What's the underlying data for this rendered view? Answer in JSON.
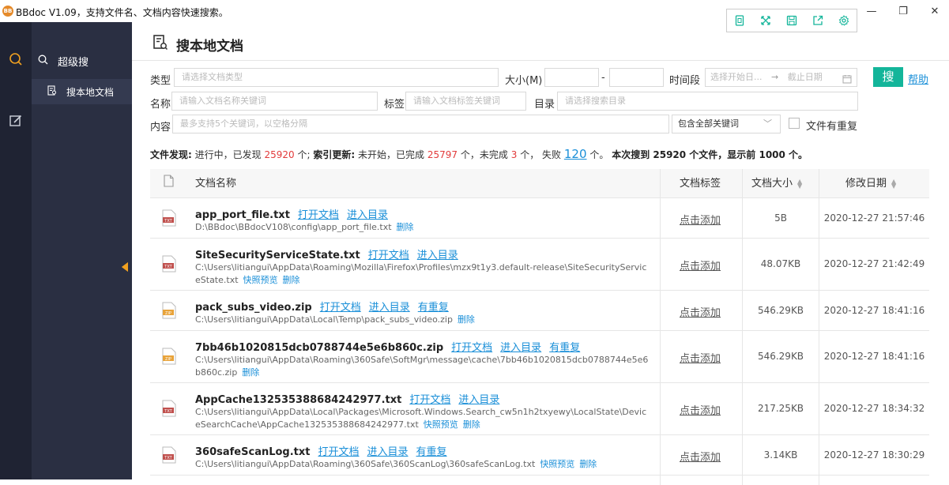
{
  "app": {
    "title": "BBdoc V1.09，支持文件名、文档内容快速搜索。",
    "logo_text": "BB"
  },
  "toolbar": {
    "icons": [
      "sim-card-icon",
      "fullscreen-icon",
      "save-icon",
      "share-icon",
      "settings-icon"
    ]
  },
  "window": {
    "minimize": "—",
    "restore": "❐",
    "close": "✕"
  },
  "subnav": {
    "section": "超级搜",
    "item": "搜本地文档"
  },
  "page": {
    "title": "搜本地文档"
  },
  "form": {
    "type_label": "类型",
    "type_placeholder": "请选择文档类型",
    "size_label": "大小(M)",
    "size_sep": "-",
    "period_label": "时间段",
    "start_placeholder": "选择开始日...",
    "end_placeholder": "截止日期",
    "name_label": "名称",
    "name_placeholder": "请输入文档名称关键词",
    "tag_label": "标签",
    "tag_placeholder": "请输入文档标签关键词",
    "dir_label": "目录",
    "dir_placeholder": "请选择搜索目录",
    "content_label": "内容",
    "content_placeholder": "最多支持5个关键词，以空格分隔",
    "match_mode": "包含全部关键词",
    "dup_label": "文件有重复",
    "search_button": "搜",
    "help_link": "帮助"
  },
  "stats": {
    "discover_label": "文件发现:",
    "discover_status": "进行中，已发现",
    "discover_count": "25920",
    "unit1": "个;",
    "index_label": "索引更新:",
    "index_status": "未开始，已完成",
    "index_done": "25797",
    "unit2": "个，未完成",
    "index_pending": "3",
    "unit3": "个，",
    "fail_label": "失败",
    "fail_count": "120",
    "unit4": "个。",
    "summary": "本次搜到 25920 个文件，显示前 1000 个。"
  },
  "table": {
    "headers": {
      "name": "文档名称",
      "tag": "文档标签",
      "size": "文档大小",
      "date": "修改日期"
    },
    "open_label": "打开文档",
    "dir_label": "进入目录",
    "dup_label": "有重复",
    "preview_label": "快照预览",
    "delete_label": "删除",
    "add_tag_label": "点击添加",
    "rows": [
      {
        "type": "TXT",
        "name": "app_port_file.txt",
        "dup": false,
        "path": "D:\\BBdoc\\BBdocV108\\config\\app_port_file.txt",
        "preview": false,
        "size": "5B",
        "date": "2020-12-27 21:57:46"
      },
      {
        "type": "TXT",
        "name": "SiteSecurityServiceState.txt",
        "dup": false,
        "path": "C:\\Users\\litiangui\\AppData\\Roaming\\Mozilla\\Firefox\\Profiles\\mzx9t1y3.default-release\\SiteSecurityServiceState.txt",
        "preview": true,
        "size": "48.07KB",
        "date": "2020-12-27 21:42:49"
      },
      {
        "type": "ZIP",
        "name": "pack_subs_video.zip",
        "dup": true,
        "path": "C:\\Users\\litiangui\\AppData\\Local\\Temp\\pack_subs_video.zip",
        "preview": false,
        "size": "546.29KB",
        "date": "2020-12-27 18:41:16"
      },
      {
        "type": "ZIP",
        "name": "7bb46b1020815dcb0788744e5e6b860c.zip",
        "dup": true,
        "path": "C:\\Users\\litiangui\\AppData\\Roaming\\360Safe\\SoftMgr\\message\\cache\\7bb46b1020815dcb0788744e5e6b860c.zip",
        "preview": false,
        "size": "546.29KB",
        "date": "2020-12-27 18:41:16"
      },
      {
        "type": "TXT",
        "name": "AppCache132535388684242977.txt",
        "dup": false,
        "path": "C:\\Users\\litiangui\\AppData\\Local\\Packages\\Microsoft.Windows.Search_cw5n1h2txyewy\\LocalState\\DeviceSearchCache\\AppCache132535388684242977.txt",
        "preview": true,
        "size": "217.25KB",
        "date": "2020-12-27 18:34:32"
      },
      {
        "type": "TXT",
        "name": "360safeScanLog.txt",
        "dup": true,
        "path": "C:\\Users\\litiangui\\AppData\\Roaming\\360Safe\\360ScanLog\\360safeScanLog.txt",
        "preview": true,
        "size": "3.14KB",
        "date": "2020-12-27 18:30:29"
      }
    ]
  },
  "colors": {
    "accent": "#13b59a",
    "link": "#1a8fd8",
    "red": "#e23b3b",
    "rail": "#1f2333",
    "subnav": "#2a2f42",
    "txt_icon": "#c0504d",
    "zip_icon": "#e8a33a",
    "collapse": "#f0a020"
  }
}
